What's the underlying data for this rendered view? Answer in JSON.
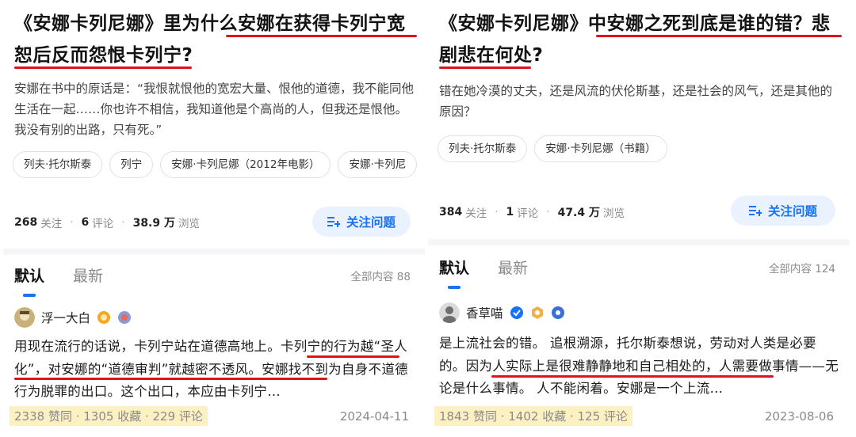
{
  "left": {
    "question": {
      "title_a": "《安娜卡列尼娜》里为什么",
      "title_b": "安娜在获得卡列宁宽",
      "title_c": "恕后反而怨恨卡列宁?",
      "excerpt": "安娜在书中的原话是：“我恨就恨他的宽宏大量、恨他的道德，我不能同他生活在一起……你也许不相信，我知道他是个高尚的人，但我还是恨他。我没有别的出路，只有死。”",
      "tags": [
        "列夫·托尔斯泰",
        "列宁",
        "安娜·卡列尼娜（2012年电影）",
        "安娜·卡列尼"
      ],
      "follow_count": "268",
      "follow_label": "关注",
      "comment_count": "6",
      "comment_label": "评论",
      "view_count": "38.9 万",
      "view_label": "浏览",
      "follow_button": "关注问题"
    },
    "tabs": {
      "default": "默认",
      "latest": "最新",
      "all": "全部内容 88"
    },
    "answer": {
      "author": "浮一大白",
      "text_1": "用现在流行的话说，卡列宁站在道德高地上。",
      "text_2": "卡列宁的行为越“圣人化”，对安娜的“道德审判”就越密不透风",
      "text_3": "。安娜找不到为自身不道德行为脱罪的出口。这个出口，本应由卡列宁…",
      "stats": "2338 赞同 · 1305 收藏 · 229 评论",
      "date": "2024-04-11"
    }
  },
  "right": {
    "question": {
      "title_a": "《安娜卡列尼娜》",
      "title_b": "中安娜之死到底是谁的错？悲",
      "title_c": "剧悲在何处?",
      "excerpt": "错在她冷漠的丈夫，还是风流的伏伦斯基，还是社会的风气，还是其他的原因？",
      "tags": [
        "列夫·托尔斯泰",
        "安娜·卡列尼娜（书籍）"
      ],
      "follow_count": "384",
      "follow_label": "关注",
      "comment_count": "1",
      "comment_label": "评论",
      "view_count": "47.4 万",
      "view_label": "浏览",
      "follow_button": "关注问题"
    },
    "tabs": {
      "default": "默认",
      "latest": "最新",
      "all": "全部内容 124"
    },
    "answer": {
      "author": "香草喵",
      "text_1": "是上流社会的错。 追根溯源，托尔斯泰想说，劳动对人类是必要的。",
      "text_2": "因为人实际上是很难静静地和自己相处的",
      "text_3": "，人需要做事情——无论是什么事情。 人不能闲着。安娜是一个上流…",
      "stats": "1843 赞同 · 1402 收藏 · 125 评论",
      "date": "2023-08-06"
    }
  },
  "colors": {
    "underline": "#e0131b",
    "accent": "#1772f6",
    "highlight": "#fdf1c4"
  }
}
